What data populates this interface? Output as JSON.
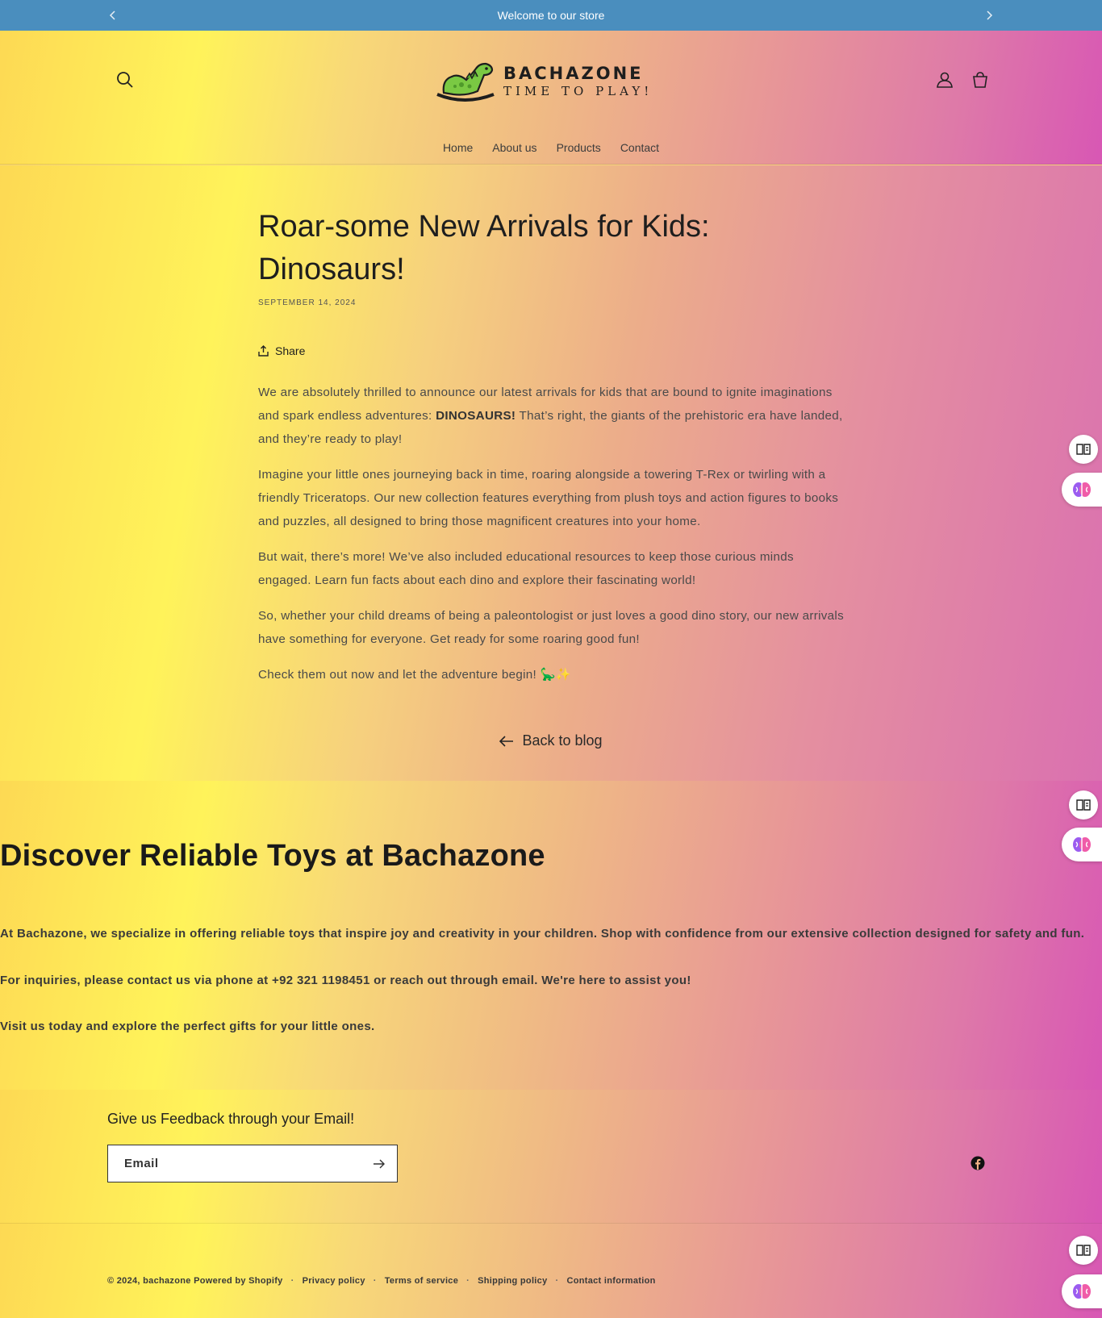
{
  "announcement": {
    "text": "Welcome to our store",
    "prev_icon": "chevron-left-icon",
    "next_icon": "chevron-right-icon"
  },
  "header": {
    "logo": {
      "title": "BACHAZONE",
      "tagline": "TIME TO PLAY!"
    },
    "nav": [
      {
        "label": "Home"
      },
      {
        "label": "About us"
      },
      {
        "label": "Products"
      },
      {
        "label": "Contact"
      }
    ],
    "icons": [
      "search-icon",
      "account-icon",
      "cart-icon"
    ]
  },
  "article": {
    "title": "Roar-some New Arrivals for Kids: Dinosaurs!",
    "date": "SEPTEMBER 14, 2024",
    "share_label": "Share",
    "p1_before": "We are absolutely thrilled to announce our latest arrivals for kids that are bound to ignite imaginations and spark endless adventures: ",
    "p1_bold": "DINOSAURS!",
    "p1_after": " That’s right, the giants of the prehistoric era have landed, and they’re ready to play!",
    "p2": "Imagine your little ones journeying back in time, roaring alongside a towering T-Rex or twirling with a friendly Triceratops. Our new collection features everything from plush toys and action figures to books and puzzles, all designed to bring those magnificent creatures into your home.",
    "p3": "But wait, there’s more! We’ve also included educational resources to keep those curious minds engaged. Learn fun facts about each dino and explore their fascinating world!",
    "p4": "So, whether your child dreams of being a paleontologist or just loves a good dino story, our new arrivals have something for everyone. Get ready for some roaring good fun!",
    "p5": "Check them out now and let the adventure begin! 🦕✨",
    "back_label": "Back to blog"
  },
  "discover": {
    "heading": "Discover Reliable Toys at Bachazone",
    "p1": "At Bachazone, we specialize in offering reliable toys that inspire joy and creativity in your children. Shop with confidence from our extensive collection designed for safety and fun.",
    "p2": "For inquiries, please contact us via phone at +92 321 1198451 or reach out through email. We're here to assist you!",
    "p3": "Visit us today and explore the perfect gifts for your little ones."
  },
  "newsletter": {
    "heading": "Give us Feedback through your Email!",
    "email_label": "Email",
    "social_icon": "facebook-icon"
  },
  "footer": {
    "copyright": "© 2024, bachazone",
    "powered": "Powered by Shopify",
    "links": [
      "Privacy policy",
      "Terms of service",
      "Shipping policy",
      "Contact information"
    ]
  },
  "floating_widgets": [
    "reader-icon",
    "brain-icon"
  ]
}
